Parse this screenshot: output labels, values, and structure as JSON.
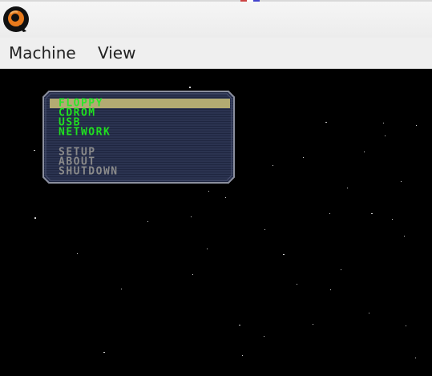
{
  "window": {
    "app_icon": "qemu-icon"
  },
  "menubar": {
    "items": [
      "Machine",
      "View"
    ]
  },
  "boot_menu": {
    "primary_items": [
      "FLOPPY",
      "CDROM",
      "USB",
      "NETWORK"
    ],
    "secondary_items": [
      "SETUP",
      "ABOUT",
      "SHUTDOWN"
    ],
    "selected": "FLOPPY"
  },
  "colors": {
    "menubar_bg": "#efefef",
    "screen_bg": "#000000",
    "panel_fill": "#2b3350",
    "panel_border": "#8b8f9e",
    "selection": "#b3ab72",
    "primary_text": "#1fe01f",
    "secondary_text": "#8a8a8a"
  }
}
